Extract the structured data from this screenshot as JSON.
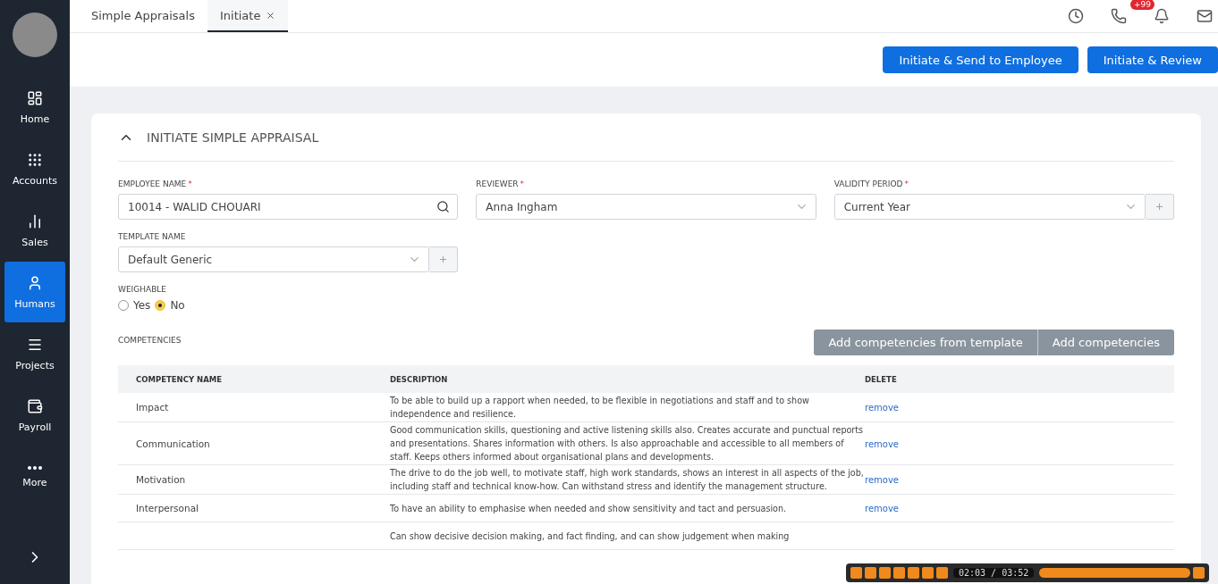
{
  "sidebar": {
    "items": [
      {
        "label": "Home",
        "selected": false
      },
      {
        "label": "Accounts",
        "selected": false
      },
      {
        "label": "Sales",
        "selected": false
      },
      {
        "label": "Humans",
        "selected": true
      },
      {
        "label": "Projects",
        "selected": false
      },
      {
        "label": "Payroll",
        "selected": false
      },
      {
        "label": "More",
        "selected": false
      }
    ]
  },
  "tabs": [
    {
      "label": "Simple Appraisals",
      "selected": false,
      "closable": false
    },
    {
      "label": "Initiate",
      "selected": true,
      "closable": true
    }
  ],
  "header_icons": {
    "notification_badge": "+99"
  },
  "actions": [
    "Initiate & Send to Employee",
    "Initiate & Review"
  ],
  "section": {
    "title": "INITIATE SIMPLE APPRAISAL",
    "expanded": true
  },
  "fields": [
    {
      "label": "EMPLOYEE NAME",
      "required_mark": "*",
      "value": "10014 - WALID CHOUARI",
      "kind": "search"
    },
    {
      "label": "REVIEWER",
      "required_mark": "*",
      "value": "Anna Ingham",
      "kind": "select"
    },
    {
      "label": "VALIDITY PERIOD",
      "required_mark": "*",
      "value": "Current Year",
      "kind": "select-add"
    },
    {
      "label": "TEMPLATE NAME",
      "value": "Default Generic",
      "kind": "select-add"
    }
  ],
  "weighable": {
    "label": "WEIGHABLE",
    "options": [
      {
        "label": "Yes",
        "selected": false
      },
      {
        "label": "No",
        "selected": true
      }
    ]
  },
  "competencies": {
    "label": "COMPETENCIES",
    "buttons": [
      "Add competencies from template",
      "Add competencies"
    ],
    "columns": [
      "COMPETENCY NAME",
      "DESCRIPTION",
      "DELETE"
    ],
    "rows": [
      {
        "name": "Impact",
        "description": "To be able to build up a rapport when needed, to be flexible in negotiations and staff and to show independence and resilience.",
        "action": "remove"
      },
      {
        "name": "Communication",
        "description": "Good communication skills, questioning and active listening skills also. Creates accurate and punctual reports and presentations. Shares information with others. Is also approachable and accessible to all members of staff. Keeps others informed about organisational plans and developments.",
        "action": "remove"
      },
      {
        "name": "Motivation",
        "description": "The drive to do the job well, to motivate staff, high work standards, shows an interest in all aspects of the job, including staff and technical know-how. Can withstand stress and identify the management structure.",
        "action": "remove"
      },
      {
        "name": "Interpersonal",
        "description": "To have an ability to emphasise when needed and show sensitivity and tact and persuasion.",
        "action": "remove"
      },
      {
        "description": "Can show decisive decision making, and fact finding, and can show judgement when making"
      }
    ]
  },
  "player": {
    "time": "02:03 / 03:52"
  }
}
